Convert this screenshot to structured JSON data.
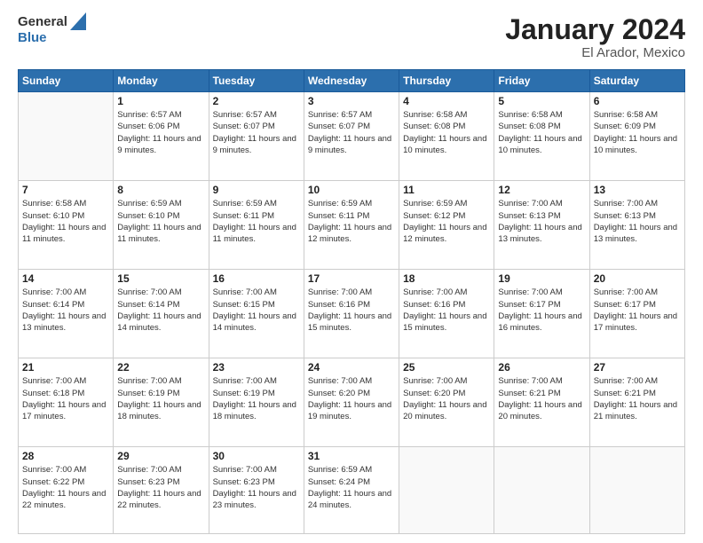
{
  "logo": {
    "line1": "General",
    "line2": "Blue"
  },
  "title": "January 2024",
  "subtitle": "El Arador, Mexico",
  "headers": [
    "Sunday",
    "Monday",
    "Tuesday",
    "Wednesday",
    "Thursday",
    "Friday",
    "Saturday"
  ],
  "weeks": [
    [
      {
        "day": "",
        "sunrise": "",
        "sunset": "",
        "daylight": ""
      },
      {
        "day": "1",
        "sunrise": "6:57 AM",
        "sunset": "6:06 PM",
        "daylight": "11 hours and 9 minutes."
      },
      {
        "day": "2",
        "sunrise": "6:57 AM",
        "sunset": "6:07 PM",
        "daylight": "11 hours and 9 minutes."
      },
      {
        "day": "3",
        "sunrise": "6:57 AM",
        "sunset": "6:07 PM",
        "daylight": "11 hours and 9 minutes."
      },
      {
        "day": "4",
        "sunrise": "6:58 AM",
        "sunset": "6:08 PM",
        "daylight": "11 hours and 10 minutes."
      },
      {
        "day": "5",
        "sunrise": "6:58 AM",
        "sunset": "6:08 PM",
        "daylight": "11 hours and 10 minutes."
      },
      {
        "day": "6",
        "sunrise": "6:58 AM",
        "sunset": "6:09 PM",
        "daylight": "11 hours and 10 minutes."
      }
    ],
    [
      {
        "day": "7",
        "sunrise": "6:58 AM",
        "sunset": "6:10 PM",
        "daylight": "11 hours and 11 minutes."
      },
      {
        "day": "8",
        "sunrise": "6:59 AM",
        "sunset": "6:10 PM",
        "daylight": "11 hours and 11 minutes."
      },
      {
        "day": "9",
        "sunrise": "6:59 AM",
        "sunset": "6:11 PM",
        "daylight": "11 hours and 11 minutes."
      },
      {
        "day": "10",
        "sunrise": "6:59 AM",
        "sunset": "6:11 PM",
        "daylight": "11 hours and 12 minutes."
      },
      {
        "day": "11",
        "sunrise": "6:59 AM",
        "sunset": "6:12 PM",
        "daylight": "11 hours and 12 minutes."
      },
      {
        "day": "12",
        "sunrise": "7:00 AM",
        "sunset": "6:13 PM",
        "daylight": "11 hours and 13 minutes."
      },
      {
        "day": "13",
        "sunrise": "7:00 AM",
        "sunset": "6:13 PM",
        "daylight": "11 hours and 13 minutes."
      }
    ],
    [
      {
        "day": "14",
        "sunrise": "7:00 AM",
        "sunset": "6:14 PM",
        "daylight": "11 hours and 13 minutes."
      },
      {
        "day": "15",
        "sunrise": "7:00 AM",
        "sunset": "6:14 PM",
        "daylight": "11 hours and 14 minutes."
      },
      {
        "day": "16",
        "sunrise": "7:00 AM",
        "sunset": "6:15 PM",
        "daylight": "11 hours and 14 minutes."
      },
      {
        "day": "17",
        "sunrise": "7:00 AM",
        "sunset": "6:16 PM",
        "daylight": "11 hours and 15 minutes."
      },
      {
        "day": "18",
        "sunrise": "7:00 AM",
        "sunset": "6:16 PM",
        "daylight": "11 hours and 15 minutes."
      },
      {
        "day": "19",
        "sunrise": "7:00 AM",
        "sunset": "6:17 PM",
        "daylight": "11 hours and 16 minutes."
      },
      {
        "day": "20",
        "sunrise": "7:00 AM",
        "sunset": "6:17 PM",
        "daylight": "11 hours and 17 minutes."
      }
    ],
    [
      {
        "day": "21",
        "sunrise": "7:00 AM",
        "sunset": "6:18 PM",
        "daylight": "11 hours and 17 minutes."
      },
      {
        "day": "22",
        "sunrise": "7:00 AM",
        "sunset": "6:19 PM",
        "daylight": "11 hours and 18 minutes."
      },
      {
        "day": "23",
        "sunrise": "7:00 AM",
        "sunset": "6:19 PM",
        "daylight": "11 hours and 18 minutes."
      },
      {
        "day": "24",
        "sunrise": "7:00 AM",
        "sunset": "6:20 PM",
        "daylight": "11 hours and 19 minutes."
      },
      {
        "day": "25",
        "sunrise": "7:00 AM",
        "sunset": "6:20 PM",
        "daylight": "11 hours and 20 minutes."
      },
      {
        "day": "26",
        "sunrise": "7:00 AM",
        "sunset": "6:21 PM",
        "daylight": "11 hours and 20 minutes."
      },
      {
        "day": "27",
        "sunrise": "7:00 AM",
        "sunset": "6:21 PM",
        "daylight": "11 hours and 21 minutes."
      }
    ],
    [
      {
        "day": "28",
        "sunrise": "7:00 AM",
        "sunset": "6:22 PM",
        "daylight": "11 hours and 22 minutes."
      },
      {
        "day": "29",
        "sunrise": "7:00 AM",
        "sunset": "6:23 PM",
        "daylight": "11 hours and 22 minutes."
      },
      {
        "day": "30",
        "sunrise": "7:00 AM",
        "sunset": "6:23 PM",
        "daylight": "11 hours and 23 minutes."
      },
      {
        "day": "31",
        "sunrise": "6:59 AM",
        "sunset": "6:24 PM",
        "daylight": "11 hours and 24 minutes."
      },
      {
        "day": "",
        "sunrise": "",
        "sunset": "",
        "daylight": ""
      },
      {
        "day": "",
        "sunrise": "",
        "sunset": "",
        "daylight": ""
      },
      {
        "day": "",
        "sunrise": "",
        "sunset": "",
        "daylight": ""
      }
    ]
  ]
}
